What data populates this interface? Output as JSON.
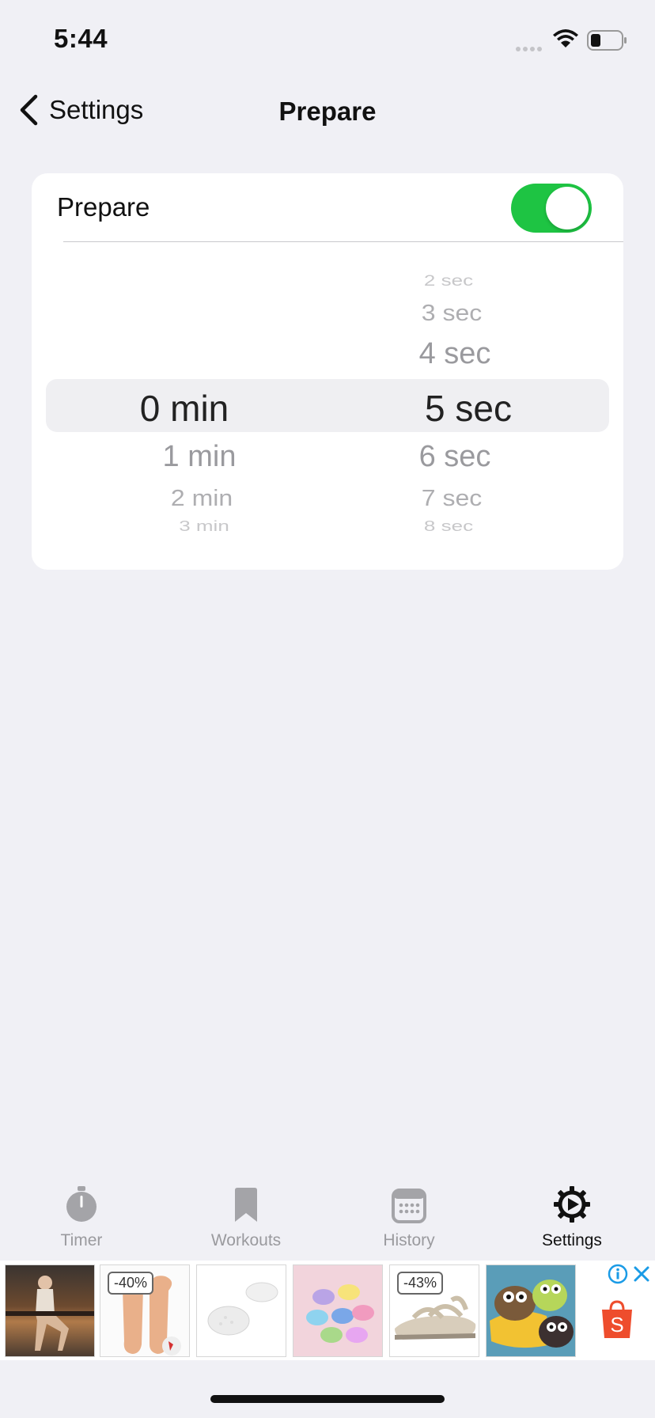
{
  "status": {
    "time": "5:44"
  },
  "nav": {
    "back_label": "Settings",
    "title": "Prepare"
  },
  "setting": {
    "label": "Prepare",
    "enabled": true
  },
  "picker": {
    "minutes": {
      "above": [],
      "selected": "0 min",
      "below": [
        "1 min",
        "2 min",
        "3 min"
      ]
    },
    "seconds": {
      "above": [
        "2 sec",
        "3 sec",
        "4 sec"
      ],
      "selected": "5 sec",
      "below": [
        "6 sec",
        "7 sec",
        "8 sec"
      ]
    }
  },
  "tabs": [
    {
      "label": "Timer",
      "icon": "stopwatch-icon",
      "active": false
    },
    {
      "label": "Workouts",
      "icon": "bookmark-icon",
      "active": false
    },
    {
      "label": "History",
      "icon": "calendar-icon",
      "active": false
    },
    {
      "label": "Settings",
      "icon": "gear-icon",
      "active": true
    }
  ],
  "ad": {
    "badges": [
      "-40%",
      "-43%"
    ],
    "shop_letter": "S"
  },
  "colors": {
    "toggle_on": "#1ec443",
    "background": "#f0f0f5",
    "ad_accent": "#ee4d2d",
    "ad_info": "#1a9be6"
  }
}
